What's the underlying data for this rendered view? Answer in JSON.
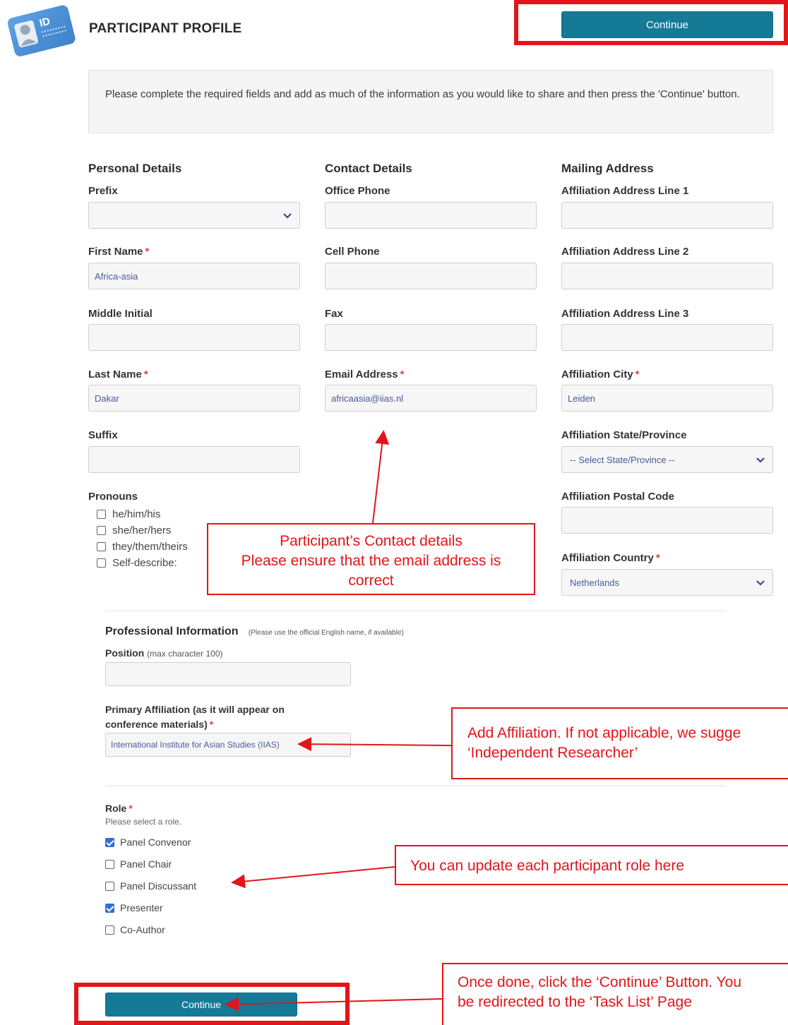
{
  "header": {
    "title": "PARTICIPANT PROFILE",
    "continue_label": "Continue"
  },
  "info": "Please complete the required fields and add as much of the information as you would like to share and then press the 'Continue' button.",
  "personal": {
    "heading": "Personal Details",
    "prefix_label": "Prefix",
    "prefix_value": "",
    "first_name_label": "First Name",
    "first_name_value": "Africa-asia",
    "middle_label": "Middle Initial",
    "middle_value": "",
    "last_name_label": "Last Name",
    "last_name_value": "Dakar",
    "suffix_label": "Suffix",
    "suffix_value": "",
    "pronouns_label": "Pronouns",
    "pronouns": [
      {
        "label": "he/him/his",
        "checked": false
      },
      {
        "label": "she/her/hers",
        "checked": false
      },
      {
        "label": "they/them/theirs",
        "checked": false
      },
      {
        "label": "Self-describe:",
        "checked": false
      }
    ]
  },
  "contact": {
    "heading": "Contact Details",
    "office_label": "Office Phone",
    "office_value": "",
    "cell_label": "Cell Phone",
    "cell_value": "",
    "fax_label": "Fax",
    "fax_value": "",
    "email_label": "Email Address",
    "email_value": "africaasia@iias.nl"
  },
  "mailing": {
    "heading": "Mailing Address",
    "addr1_label": "Affiliation Address Line 1",
    "addr1_value": "",
    "addr2_label": "Affiliation Address Line 2",
    "addr2_value": "",
    "addr3_label": "Affiliation Address Line 3",
    "addr3_value": "",
    "city_label": "Affiliation City",
    "city_value": "Leiden",
    "state_label": "Affiliation State/Province",
    "state_value": "-- Select State/Province --",
    "postal_label": "Affiliation Postal Code",
    "postal_value": "",
    "country_label": "Affiliation Country",
    "country_value": "Netherlands"
  },
  "professional": {
    "heading": "Professional Information",
    "heading_note": "(Please use the official English name, if available)",
    "position_label": "Position",
    "position_note": "(max character 100)",
    "position_value": "",
    "affiliation_label_1": "Primary Affiliation (as it will appear on",
    "affiliation_label_2": "conference materials)",
    "affiliation_value": "International Institute for Asian Studies (IIAS)"
  },
  "role": {
    "label": "Role",
    "hint": "Please select a role.",
    "options": [
      {
        "label": "Panel Convenor",
        "checked": true
      },
      {
        "label": "Panel Chair",
        "checked": false
      },
      {
        "label": "Panel Discussant",
        "checked": false
      },
      {
        "label": "Presenter",
        "checked": true
      },
      {
        "label": "Co-Author",
        "checked": false
      }
    ]
  },
  "annotations": {
    "contact_line1": "Participant’s Contact details",
    "contact_line2": "Please ensure that the email address is",
    "contact_line3": "correct",
    "affil_line1": "Add Affiliation. If not applicable, we sugge",
    "affil_line2": "‘Independent Researcher’",
    "role_line": "You can update each participant role here",
    "continue_line1": "Once done, click the ‘Continue’ Button. You",
    "continue_line2": "be redirected to the ‘Task List’ Page"
  },
  "required_mark": "*",
  "icons": {
    "header": "id-card-icon",
    "select": "chevron-down-icon"
  },
  "colors": {
    "primary_button": "#157a96",
    "required": "#d9443a",
    "annotation": "#e3151a",
    "checkbox_checked": "#2f6fd6"
  }
}
